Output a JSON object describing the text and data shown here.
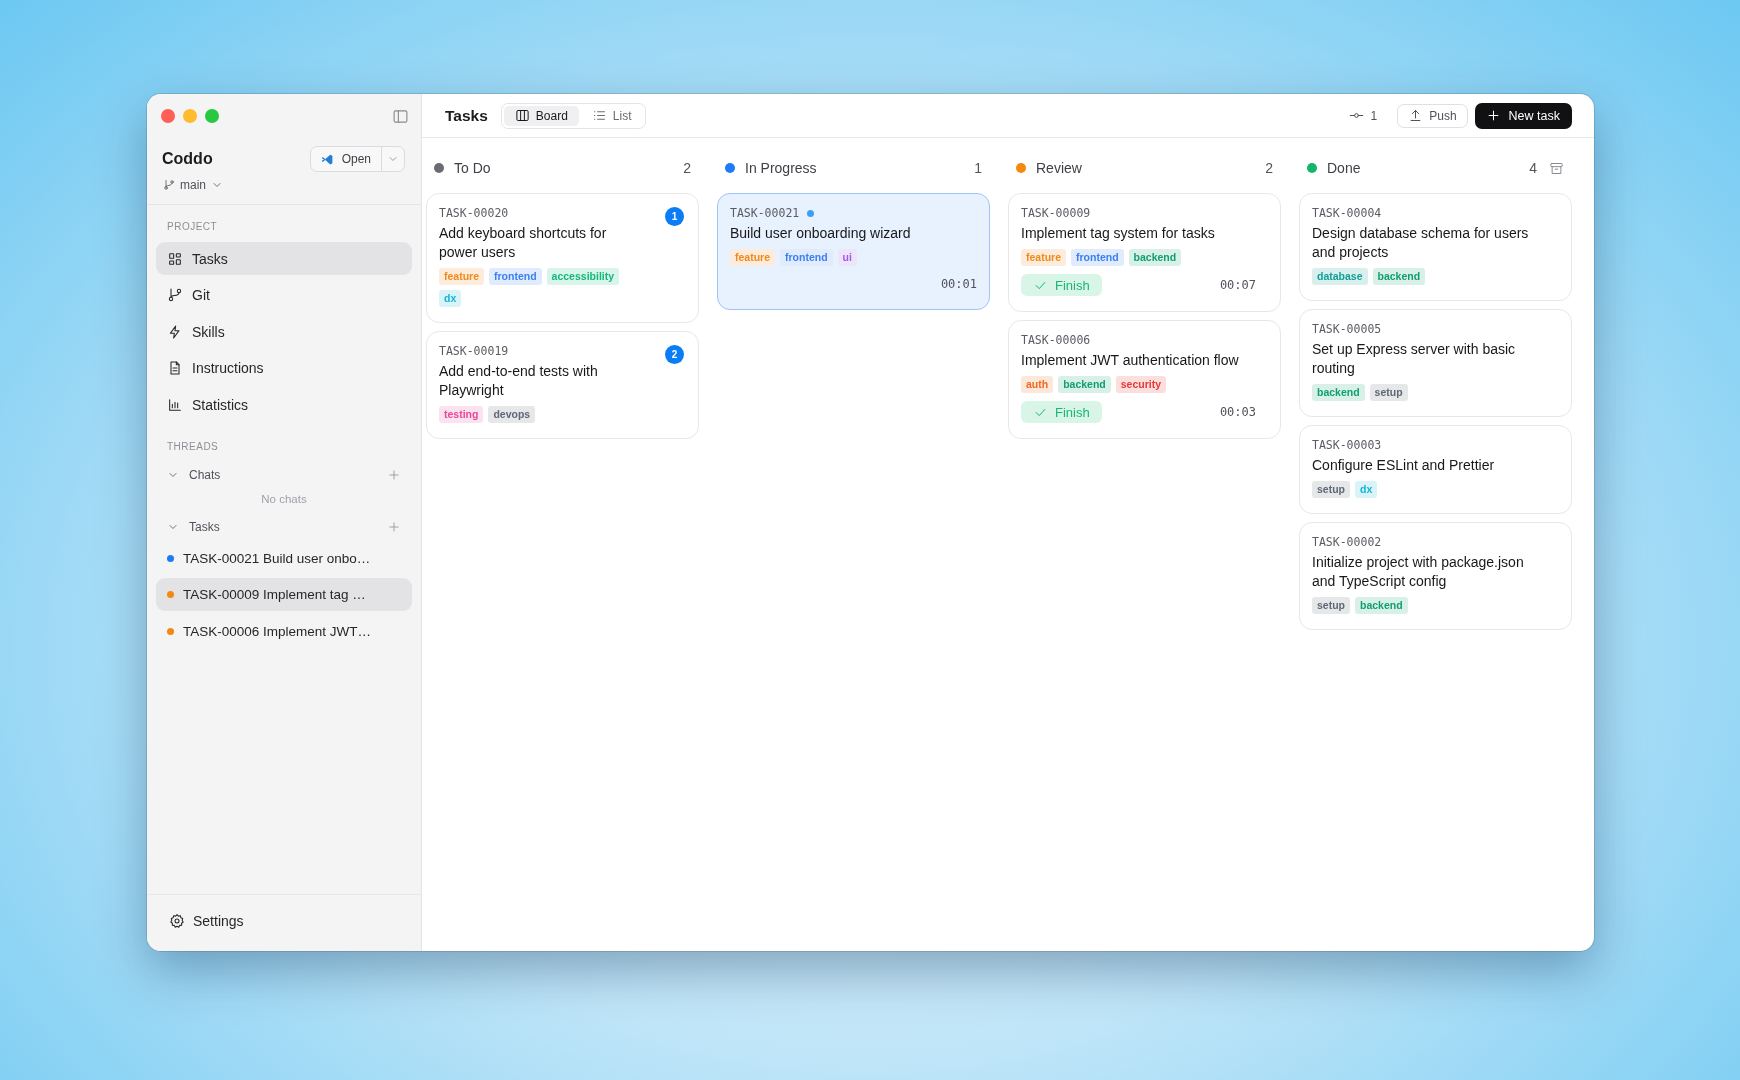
{
  "sidebar": {
    "project": {
      "name": "Coddo",
      "branch": "main",
      "open_button": "Open"
    },
    "nav": {
      "title": "PROJECT",
      "items": [
        {
          "label": "Tasks",
          "selected": true
        },
        {
          "label": "Git",
          "selected": false
        },
        {
          "label": "Skills",
          "selected": false
        },
        {
          "label": "Instructions",
          "selected": false
        },
        {
          "label": "Statistics",
          "selected": false
        }
      ]
    },
    "threads": {
      "title": "THREADS",
      "groups": [
        {
          "label": "Chats",
          "expanded": true,
          "empty_text": "No chats"
        },
        {
          "label": "Tasks",
          "expanded": true,
          "items": [
            {
              "label": "TASK-00021 Build user onbo…",
              "color": "#1d7bf5",
              "selected": false
            },
            {
              "label": "TASK-00009 Implement tag …",
              "color": "#f5880f",
              "selected": true
            },
            {
              "label": "TASK-00006 Implement JWT…",
              "color": "#f5880f",
              "selected": false
            }
          ]
        }
      ]
    },
    "settings": "Settings"
  },
  "header": {
    "title": "Tasks",
    "tabs": [
      {
        "label": "Board",
        "selected": true
      },
      {
        "label": "List",
        "selected": false
      }
    ],
    "commits": "1",
    "push_button": "Push",
    "new_button": "New task"
  },
  "board": {
    "columns": [
      {
        "name": "To Do",
        "color": "#6b6b73",
        "count": "2",
        "archive_button": false,
        "cards": [
          {
            "id": "TASK-00020",
            "title": "Add keyboard shortcuts for power users",
            "selected": false,
            "live": false,
            "badge": "1",
            "tags": [
              {
                "label": "feature",
                "color": "#f08a1c"
              },
              {
                "label": "frontend",
                "color": "#3b7ff0"
              },
              {
                "label": "accessibility",
                "color": "#14b87a"
              },
              {
                "label": "dx",
                "color": "#14b4d6"
              }
            ]
          },
          {
            "id": "TASK-00019",
            "title": "Add end-to-end tests with Playwright",
            "selected": false,
            "live": false,
            "badge": "2",
            "tags": [
              {
                "label": "testing",
                "color": "#e8479a"
              },
              {
                "label": "devops",
                "color": "#5f6877"
              }
            ]
          }
        ]
      },
      {
        "name": "In Progress",
        "color": "#1d7bf5",
        "count": "1",
        "archive_button": false,
        "cards": [
          {
            "id": "TASK-00021",
            "title": "Build user onboarding wizard",
            "selected": true,
            "live": true,
            "timer": "00:01",
            "tags": [
              {
                "label": "feature",
                "color": "#f08a1c"
              },
              {
                "label": "frontend",
                "color": "#3b7ff0"
              },
              {
                "label": "ui",
                "color": "#9b5ce8"
              }
            ]
          }
        ]
      },
      {
        "name": "Review",
        "color": "#f5880f",
        "count": "2",
        "archive_button": false,
        "cards": [
          {
            "id": "TASK-00009",
            "title": "Implement tag system for tasks",
            "selected": false,
            "live": false,
            "finish_button": "Finish",
            "timer": "00:07",
            "tags": [
              {
                "label": "feature",
                "color": "#f08a1c"
              },
              {
                "label": "frontend",
                "color": "#3b7ff0"
              },
              {
                "label": "backend",
                "color": "#0f9f6e"
              }
            ]
          },
          {
            "id": "TASK-00006",
            "title": "Implement JWT authentication flow",
            "selected": false,
            "live": false,
            "finish_button": "Finish",
            "timer": "00:03",
            "tags": [
              {
                "label": "auth",
                "color": "#ee6a1f"
              },
              {
                "label": "backend",
                "color": "#0f9f6e"
              },
              {
                "label": "security",
                "color": "#e53935"
              }
            ]
          }
        ]
      },
      {
        "name": "Done",
        "color": "#16b36b",
        "count": "4",
        "archive_button": true,
        "cards": [
          {
            "id": "TASK-00004",
            "title": "Design database schema for users and projects",
            "selected": false,
            "live": false,
            "tags": [
              {
                "label": "database",
                "color": "#119e96"
              },
              {
                "label": "backend",
                "color": "#0f9f6e"
              }
            ]
          },
          {
            "id": "TASK-00005",
            "title": "Set up Express server with basic routing",
            "selected": false,
            "live": false,
            "tags": [
              {
                "label": "backend",
                "color": "#0f9f6e"
              },
              {
                "label": "setup",
                "color": "#5f6877"
              }
            ]
          },
          {
            "id": "TASK-00003",
            "title": "Configure ESLint and Prettier",
            "selected": false,
            "live": false,
            "tags": [
              {
                "label": "setup",
                "color": "#5f6877"
              },
              {
                "label": "dx",
                "color": "#14b4d6"
              }
            ]
          },
          {
            "id": "TASK-00002",
            "title": "Initialize project with package.json and TypeScript config",
            "selected": false,
            "live": false,
            "tags": [
              {
                "label": "setup",
                "color": "#5f6877"
              },
              {
                "label": "backend",
                "color": "#0f9f6e"
              }
            ]
          }
        ]
      }
    ]
  }
}
